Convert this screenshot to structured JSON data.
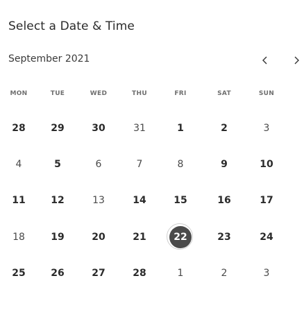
{
  "title": "Select a Date & Time",
  "calendar": {
    "month_label": "September 2021",
    "prev_icon": "chevron-left-icon",
    "next_icon": "chevron-right-icon",
    "weekdays": [
      "MON",
      "TUE",
      "WED",
      "THU",
      "FRI",
      "SAT",
      "SUN"
    ],
    "selected_day": "22",
    "weeks": [
      [
        "28",
        "29",
        "30",
        "31",
        "1",
        "2",
        "3"
      ],
      [
        "4",
        "5",
        "6",
        "7",
        "8",
        "9",
        "10"
      ],
      [
        "11",
        "12",
        "13",
        "14",
        "15",
        "16",
        "17"
      ],
      [
        "18",
        "19",
        "20",
        "21",
        "22",
        "23",
        "24"
      ],
      [
        "25",
        "26",
        "27",
        "28",
        "1",
        "2",
        "3"
      ]
    ],
    "accent_color": "#4a4a4a"
  }
}
